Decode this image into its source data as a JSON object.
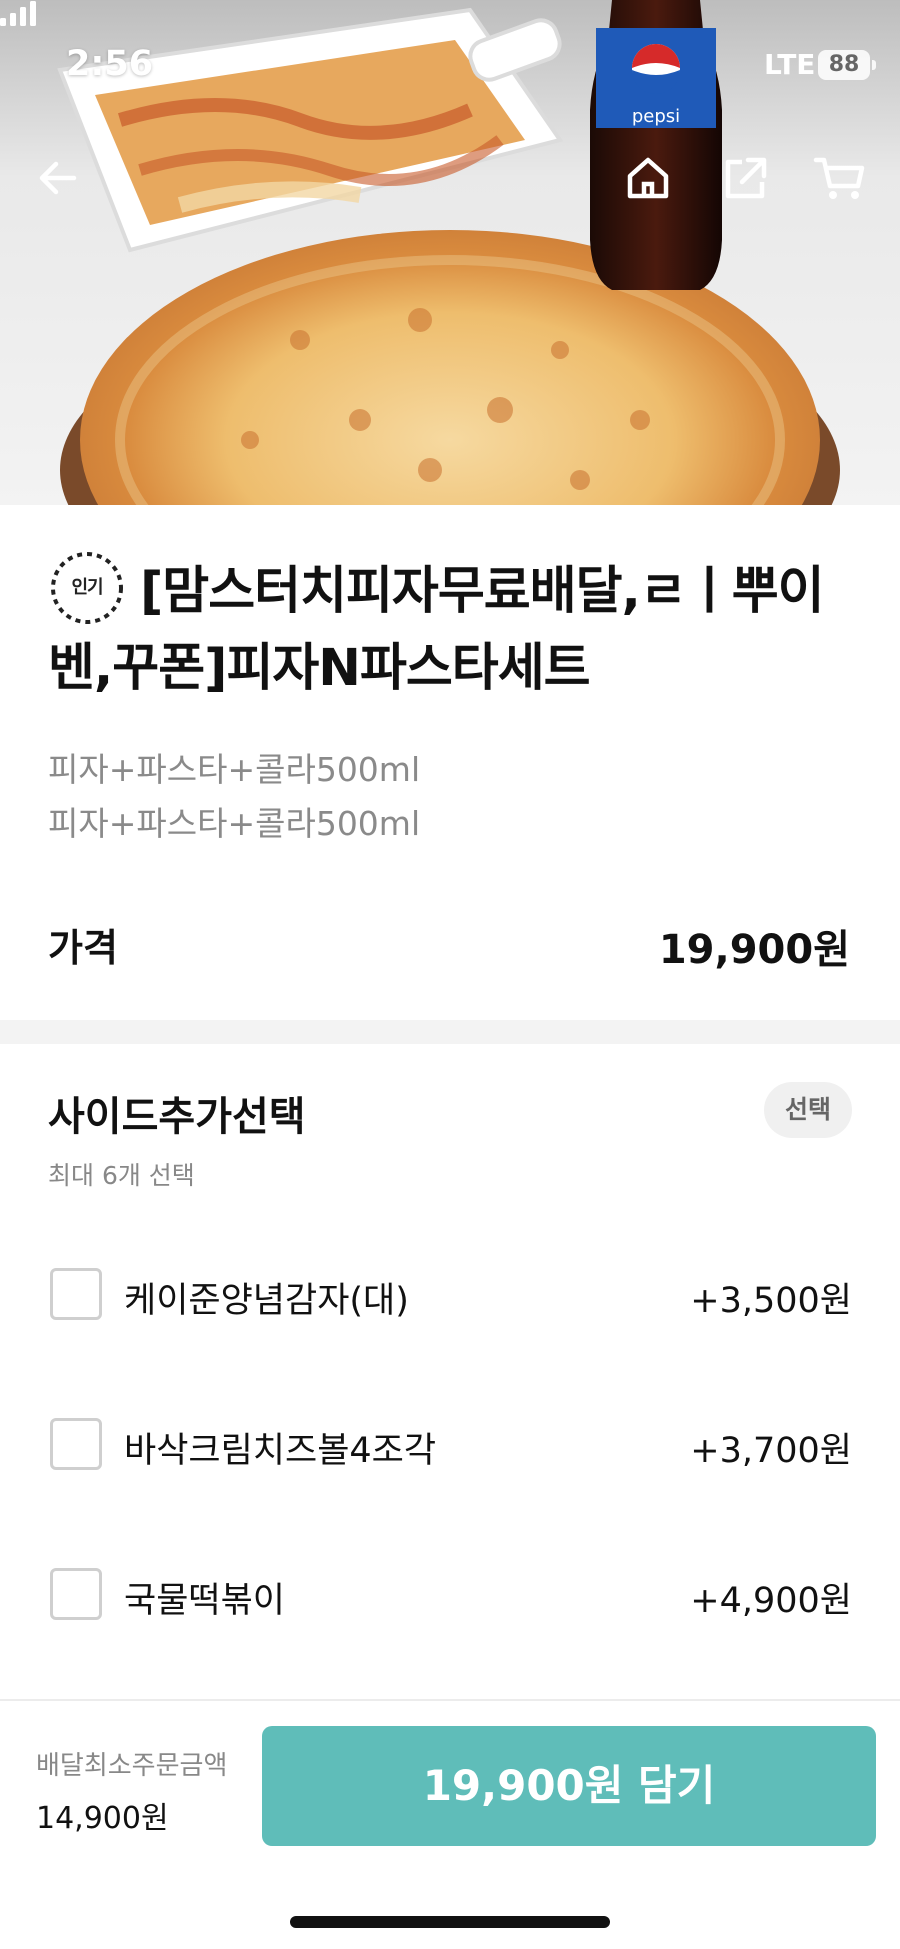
{
  "status_bar": {
    "time": "2:56",
    "network": "LTE",
    "battery": "88"
  },
  "nav": {
    "back_icon": "arrow-left-icon",
    "home_icon": "home-icon",
    "share_icon": "share-icon",
    "cart_icon": "cart-icon"
  },
  "product": {
    "badge": "인기",
    "title": "[맘스터치피자무료배달,ㄹㅣ뿌이벤,꾸폰]피자N파스타세트",
    "description_lines": [
      "피자+파스타+콜라500ml",
      "피자+파스타+콜라500ml"
    ],
    "price_label": "가격",
    "price_value": "19,900원",
    "hero_bottle_text": "pepsi"
  },
  "side_options": {
    "title": "사이드추가선택",
    "tag": "선택",
    "subtitle": "최대 6개 선택",
    "items": [
      {
        "name": "케이준양념감자(대)",
        "price": "+3,500원",
        "checked": false
      },
      {
        "name": "바삭크림치즈볼4조각",
        "price": "+3,700원",
        "checked": false
      },
      {
        "name": "국물떡볶이",
        "price": "+4,900원",
        "checked": false
      }
    ]
  },
  "bottom_bar": {
    "min_order_label": "배달최소주문금액",
    "min_order_value": "14,900원",
    "cart_button_label": "19,900원 담기"
  },
  "colors": {
    "accent": "#5fbdb9",
    "text_primary": "#111111",
    "text_secondary": "#888888",
    "divider": "#f3f3f3"
  }
}
